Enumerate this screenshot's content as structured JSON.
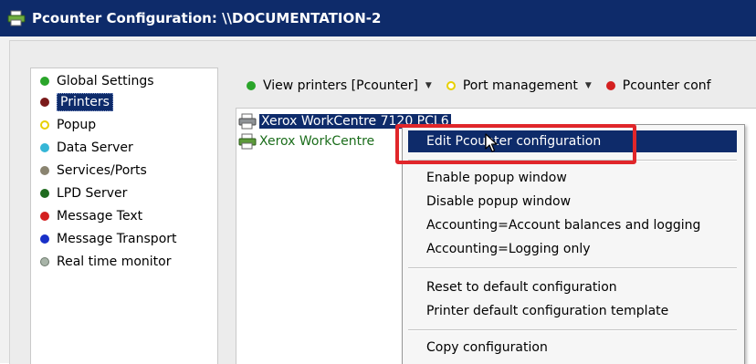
{
  "window": {
    "title": "Pcounter Configuration: \\\\DOCUMENTATION-2",
    "icon": "printer-icon"
  },
  "sidebar": {
    "items": [
      {
        "label": "Global Settings",
        "color": "#2aa52a",
        "style": "filled",
        "selected": false
      },
      {
        "label": "Printers",
        "color": "#7a1a1a",
        "style": "filled",
        "selected": true
      },
      {
        "label": "Popup",
        "color": "#e8d000",
        "style": "hollow",
        "selected": false
      },
      {
        "label": "Data Server",
        "color": "#35b6d6",
        "style": "filled",
        "selected": false
      },
      {
        "label": "Services/Ports",
        "color": "#8a8470",
        "style": "filled",
        "selected": false
      },
      {
        "label": "LPD Server",
        "color": "#1f6b1f",
        "style": "filled",
        "selected": false
      },
      {
        "label": "Message Text",
        "color": "#d42020",
        "style": "filled",
        "selected": false
      },
      {
        "label": "Message Transport",
        "color": "#1830c8",
        "style": "filled",
        "selected": false
      },
      {
        "label": "Real time monitor",
        "color": "#a8b4a8",
        "style": "filled",
        "selected": false
      }
    ]
  },
  "toolbar": {
    "items": [
      {
        "label": "View printers [Pcounter]",
        "color": "#2aa52a",
        "style": "filled",
        "dropdown": true
      },
      {
        "label": "Port management",
        "color": "#e8d000",
        "style": "hollow",
        "dropdown": true
      },
      {
        "label": "Pcounter conf",
        "color": "#d42020",
        "style": "filled",
        "dropdown": false
      }
    ]
  },
  "printers": [
    {
      "name": "Xerox WorkCentre 7120 PCL6",
      "selected": true
    },
    {
      "name": "Xerox WorkCentre",
      "selected": false
    }
  ],
  "context_menu": {
    "groups": [
      [
        "Edit Pcounter configuration"
      ],
      [
        "Enable popup window",
        "Disable popup window",
        "Accounting=Account balances and logging",
        "Accounting=Logging only"
      ],
      [
        "Reset to default configuration",
        "Printer default configuration template"
      ],
      [
        "Copy configuration"
      ]
    ],
    "highlighted": "Edit Pcounter configuration",
    "highlight_color": "#e0262a"
  }
}
